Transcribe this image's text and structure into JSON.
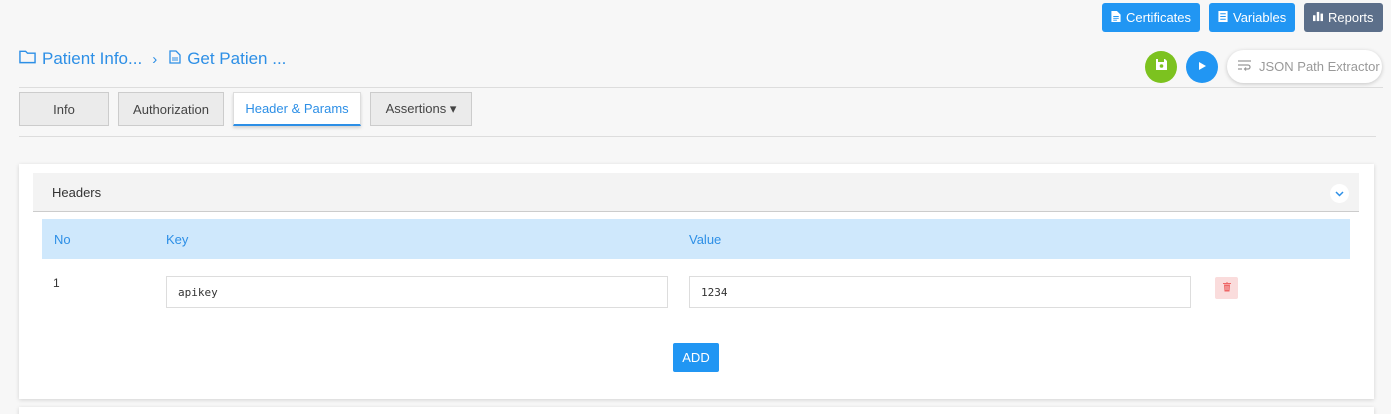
{
  "toolbar": {
    "certificates_label": "Certificates",
    "variables_label": "Variables",
    "reports_label": "Reports"
  },
  "breadcrumb": {
    "folder_label": "Patient Info...",
    "request_label": "Get Patien ..."
  },
  "actions": {
    "json_extractor_label": "JSON Path Extractor"
  },
  "tabs": [
    {
      "label": "Info",
      "active": false
    },
    {
      "label": "Authorization",
      "active": false
    },
    {
      "label": "Header & Params",
      "active": true
    },
    {
      "label": "Assertions ▾",
      "active": false
    }
  ],
  "headers_panel": {
    "title": "Headers",
    "columns": {
      "no": "No",
      "key": "Key",
      "value": "Value"
    },
    "rows": [
      {
        "no": "1",
        "key": "apikey",
        "value": "1234"
      }
    ],
    "add_label": "ADD"
  },
  "colors": {
    "primary": "#2196f3",
    "save": "#7cc21f",
    "reports": "#5c6f8a",
    "delete_bg": "#fadcdc",
    "table_head": "#cfe8fc"
  },
  "icons": {
    "certificates": "document-icon",
    "variables": "list-icon",
    "reports": "bar-chart-icon",
    "folder": "folder-icon",
    "request": "document-icon",
    "save": "save-icon",
    "run": "play-icon",
    "json": "wrap-text-icon",
    "collapse": "chevron-down-icon",
    "delete": "trash-icon"
  }
}
